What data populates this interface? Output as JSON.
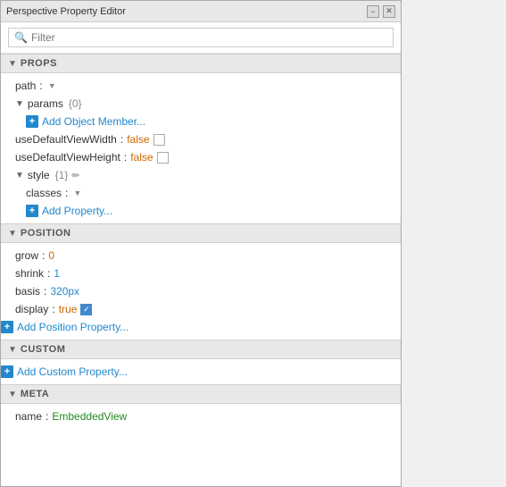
{
  "window": {
    "title": "Perspective Property Editor",
    "minimize_label": "−",
    "close_label": "✕"
  },
  "search": {
    "placeholder": "Filter"
  },
  "sections": {
    "props": {
      "label": "PROPS",
      "items": [
        {
          "name": "path",
          "colon": ":",
          "value": "",
          "type": "dropdown"
        },
        {
          "name": "params",
          "colon": "",
          "count": "{0}",
          "type": "expandable",
          "add_label": "Add Object Member..."
        },
        {
          "name": "useDefaultViewWidth",
          "colon": ":",
          "value": "false",
          "type": "checkbox",
          "checked": false
        },
        {
          "name": "useDefaultViewHeight",
          "colon": ":",
          "value": "false",
          "type": "checkbox",
          "checked": false
        },
        {
          "name": "style",
          "colon": "",
          "count": "{1}",
          "type": "expandable-edit",
          "children": [
            {
              "name": "classes",
              "colon": ":",
              "type": "dropdown"
            }
          ],
          "add_label": "Add Property..."
        }
      ]
    },
    "position": {
      "label": "POSITION",
      "items": [
        {
          "name": "grow",
          "colon": ":",
          "value": "0",
          "type": "number-orange"
        },
        {
          "name": "shrink",
          "colon": ":",
          "value": "1",
          "type": "number-blue"
        },
        {
          "name": "basis",
          "colon": ":",
          "value": "320px",
          "type": "string-blue"
        },
        {
          "name": "display",
          "colon": ":",
          "value": "true",
          "type": "checkbox-true",
          "checked": true
        },
        {
          "add_label": "Add Position Property...",
          "type": "add-only"
        }
      ]
    },
    "custom": {
      "label": "CUSTOM",
      "add_label": "Add Custom Property..."
    },
    "meta": {
      "label": "META",
      "items": [
        {
          "name": "name",
          "colon": ":",
          "value": "EmbeddedView",
          "type": "string-green"
        }
      ]
    }
  }
}
